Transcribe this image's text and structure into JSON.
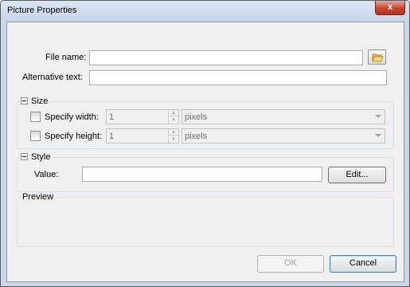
{
  "window": {
    "title": "Picture Properties",
    "close_label": "x"
  },
  "form": {
    "file_name_label": "File name:",
    "file_name_value": "",
    "alt_text_label": "Alternative text:",
    "alt_text_value": ""
  },
  "size": {
    "header": "Size",
    "width_label": "Specify width:",
    "width_value": "1",
    "width_unit": "pixels",
    "height_label": "Specify height:",
    "height_value": "1",
    "height_unit": "pixels"
  },
  "style": {
    "header": "Style",
    "value_label": "Value:",
    "value": "",
    "edit_label": "Edit..."
  },
  "preview": {
    "header": "Preview"
  },
  "buttons": {
    "ok_label": "OK",
    "cancel_label": "Cancel"
  }
}
